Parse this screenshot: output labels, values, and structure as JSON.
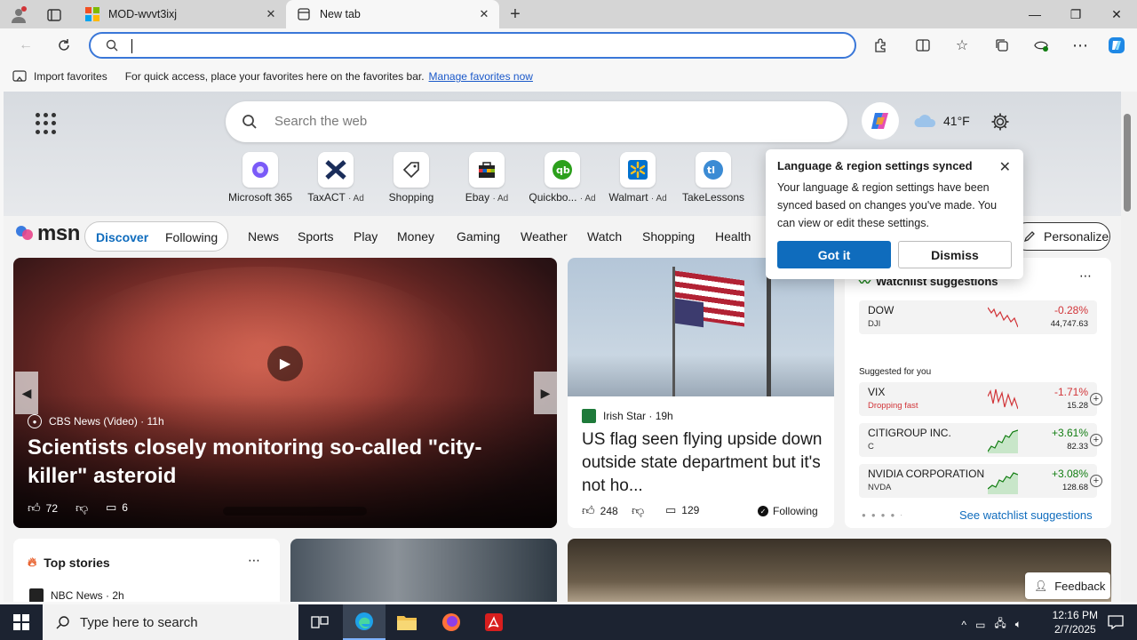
{
  "tabs": [
    {
      "title": "MOD-wvvt3ixj"
    },
    {
      "title": "New tab"
    }
  ],
  "address_bar": {
    "value": "",
    "placeholder": ""
  },
  "favorites_bar": {
    "import_label": "Import favorites",
    "hint": "For quick access, place your favorites here on the favorites bar.",
    "manage_link": "Manage favorites now"
  },
  "page_search": {
    "placeholder": "Search the web"
  },
  "weather": {
    "temp": "41°F"
  },
  "quick_links": [
    {
      "label": "Microsoft 365",
      "ad": ""
    },
    {
      "label": "TaxACT",
      "ad": "· Ad"
    },
    {
      "label": "Shopping",
      "ad": ""
    },
    {
      "label": "Ebay",
      "ad": "· Ad"
    },
    {
      "label": "Quickbo...",
      "ad": "· Ad"
    },
    {
      "label": "Walmart",
      "ad": "· Ad"
    },
    {
      "label": "TakeLessons",
      "ad": ""
    }
  ],
  "msn": {
    "logo": "msn",
    "discover": "Discover",
    "following": "Following",
    "nav": [
      "News",
      "Sports",
      "Play",
      "Money",
      "Gaming",
      "Weather",
      "Watch",
      "Shopping",
      "Health"
    ],
    "personalize": "Personalize"
  },
  "hero": {
    "source": "CBS News (Video)",
    "time": "11h",
    "title": "Scientists closely monitoring so-called \"city-killer\" asteroid",
    "likes": "72",
    "comments": "6"
  },
  "card2": {
    "source": "Irish Star",
    "time": "19h",
    "title": "US flag seen flying upside down outside state department but it's not ho...",
    "likes": "248",
    "comments": "129",
    "following": "Following"
  },
  "watchlist": {
    "title": "Watchlist suggestions",
    "suggested_label": "Suggested for you",
    "see_more": "See watchlist suggestions",
    "main": {
      "name": "DOW",
      "ticker": "DJI",
      "change": "-0.28%",
      "price": "44,747.63"
    },
    "items": [
      {
        "name": "VIX",
        "ticker": "Dropping fast",
        "change": "-1.71%",
        "price": "15.28"
      },
      {
        "name": "CITIGROUP INC.",
        "ticker": "C",
        "change": "+3.61%",
        "price": "82.33"
      },
      {
        "name": "NVIDIA CORPORATION",
        "ticker": "NVDA",
        "change": "+3.08%",
        "price": "128.68"
      }
    ]
  },
  "top_stories": {
    "title": "Top stories",
    "first_source": "NBC News · 2h"
  },
  "feedback": "Feedback",
  "popup": {
    "title": "Language & region settings synced",
    "body": "Your language & region settings have been synced based on changes you've made. You can view or edit these settings.",
    "got_it": "Got it",
    "dismiss": "Dismiss"
  },
  "taskbar": {
    "search_placeholder": "Type here to search",
    "time": "12:16 PM",
    "date": "2/7/2025"
  },
  "colors": {
    "accent": "#0f6cbd",
    "negative": "#d13438",
    "positive": "#107c10"
  }
}
